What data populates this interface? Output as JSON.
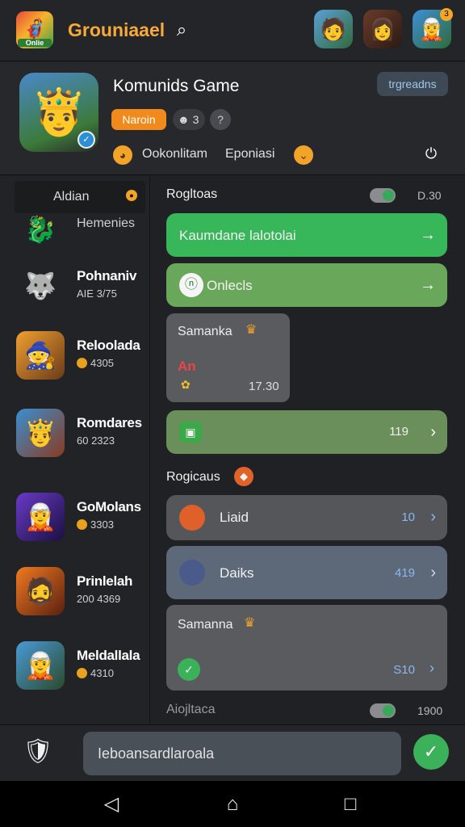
{
  "topbar": {
    "logo_text": "Onlie",
    "app_title": "Grouniaael",
    "avatars": [
      "hero-avatar-1",
      "hero-avatar-2",
      "hero-avatar-3"
    ],
    "avatar_badge": "3"
  },
  "header": {
    "title": "Komunids Game",
    "tag": "trgreadns",
    "orange_pill": "Naroin",
    "member_count": "3",
    "question": "?",
    "meta_left": "Ookonlitam",
    "meta_right": "Eponiasi"
  },
  "sidebar": {
    "head_label": "Aldian",
    "first_label": "Hemenies",
    "items": [
      {
        "name": "Pohnaniv",
        "score": "AIE 3/75"
      },
      {
        "name": "Reloolada",
        "score": "4305"
      },
      {
        "name": "Romdares",
        "score": "60 2323"
      },
      {
        "name": "GoMolans",
        "score": "3303"
      },
      {
        "name": "Prinlelah",
        "score": "200 4369"
      },
      {
        "name": "Meldallala",
        "score": "4310"
      }
    ]
  },
  "main": {
    "section1_title": "Rogltoas",
    "section1_value": "D.30",
    "row1_label": "Kaumdane lalotolai",
    "row2_label": "Onlecls",
    "bubble1_name": "Samanka",
    "bubble1_tag": "An",
    "bubble1_time": "17.30",
    "row3_value": "119",
    "section2_title": "Rogicaus",
    "row4_label": "Liaid",
    "row4_value": "10",
    "row5_label": "Daiks",
    "row5_value": "419",
    "bubble2_name": "Samanna",
    "bubble2_value": "S10",
    "section3_title": "Aiojltaca",
    "section3_value": "1900"
  },
  "composer": {
    "input_value": "Ieboansardlaroala"
  },
  "colors": {
    "accent_orange": "#f08a1c",
    "accent_green": "#37b65a",
    "background": "#202124"
  }
}
